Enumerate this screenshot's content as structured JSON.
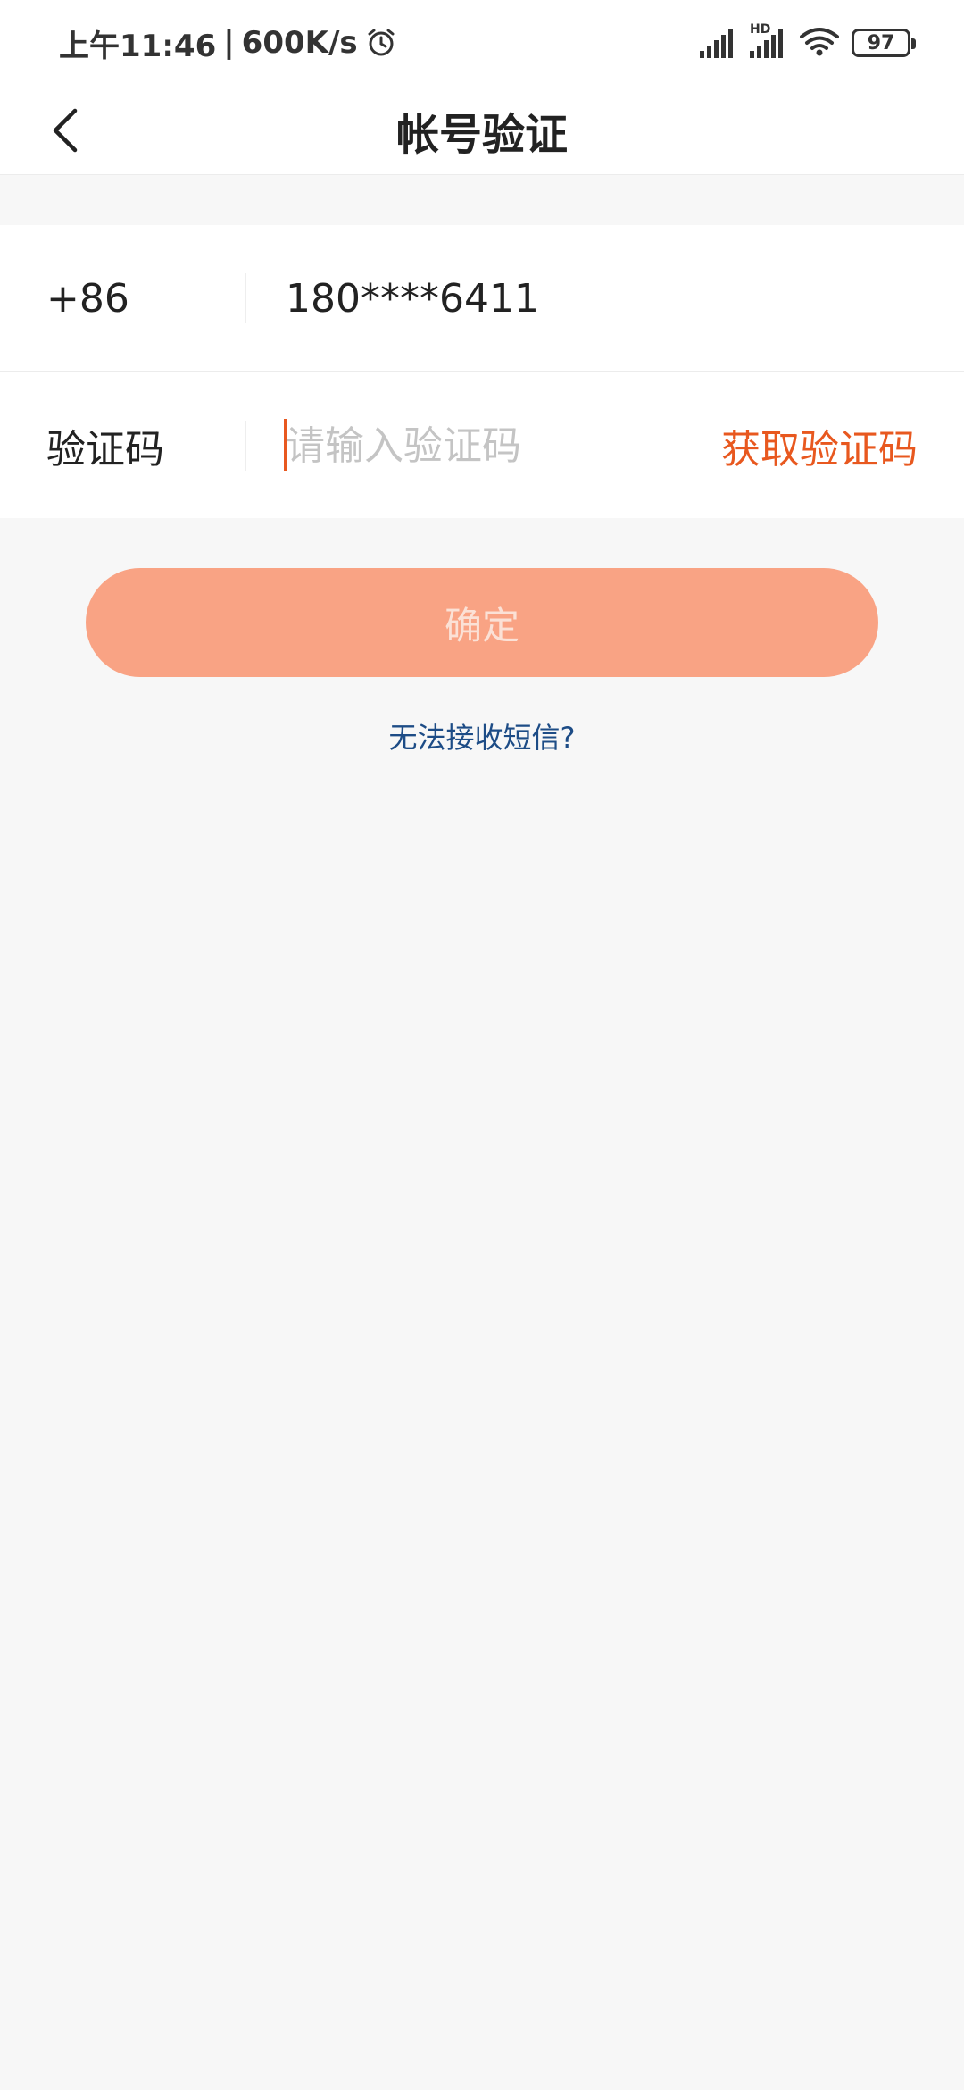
{
  "status_bar": {
    "time": "上午11:46",
    "separator": "|",
    "speed": "600K/s",
    "hd_label": "HD",
    "battery": "97"
  },
  "header": {
    "title": "帐号验证",
    "back_icon": "chevron-left-icon"
  },
  "form": {
    "phone": {
      "country_code": "+86",
      "number": "180****6411"
    },
    "code": {
      "label": "验证码",
      "placeholder": "请输入验证码",
      "value": "",
      "get_code_label": "获取验证码"
    }
  },
  "confirm_label": "确定",
  "help_link": "无法接收短信?",
  "colors": {
    "accent": "#e8581f",
    "button_bg": "#f9a384",
    "button_text": "#fbe1d6",
    "link": "#1d4c86",
    "page_bg": "#f7f7f7"
  }
}
